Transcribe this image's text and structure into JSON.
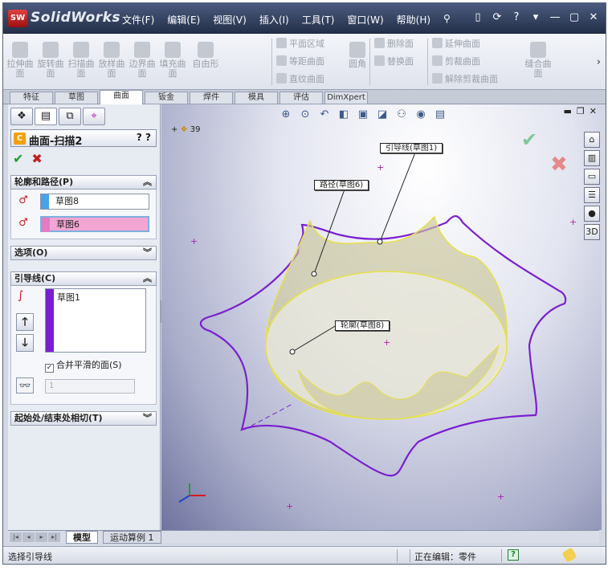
{
  "app": {
    "brand": "SolidWorks",
    "logo_text": "SW",
    "menus": [
      "文件(F)",
      "编辑(E)",
      "视图(V)",
      "插入(I)",
      "工具(T)",
      "窗口(W)",
      "帮助(H)"
    ],
    "title_buttons": [
      "?",
      "▾",
      "—",
      "▢",
      "✕"
    ]
  },
  "ribbon": {
    "tools": [
      {
        "label": "拉伸曲\n面",
        "icon": "extrude-surface-icon"
      },
      {
        "label": "旋转曲\n面",
        "icon": "revolve-surface-icon"
      },
      {
        "label": "扫描曲\n面",
        "icon": "sweep-surface-icon"
      },
      {
        "label": "放样曲\n面",
        "icon": "loft-surface-icon"
      },
      {
        "label": "边界曲\n面",
        "icon": "boundary-surface-icon"
      },
      {
        "label": "填充曲\n面",
        "icon": "fill-surface-icon"
      },
      {
        "label": "自由形",
        "icon": "freeform-icon"
      }
    ],
    "col1": [
      "平面区域",
      "等距曲面",
      "直纹曲面"
    ],
    "round": "圆角",
    "col2": [
      "删除面",
      "替换面"
    ],
    "col3": [
      "延伸曲面",
      "剪裁曲面",
      "解除剪裁曲面"
    ],
    "knit": "缝合曲\n面",
    "more": "›"
  },
  "cmd_tabs": [
    "特征",
    "草图",
    "曲面",
    "钣金",
    "焊件",
    "模具",
    "评估",
    "DimXpert"
  ],
  "active_tab": "曲面",
  "panel": {
    "feature_title": "曲面-扫描2",
    "help": "? ?",
    "ok": "✔",
    "cancel": "✖",
    "section_profile": "轮廓和路径(P)",
    "profile_value": "草图8",
    "path_value": "草图6",
    "section_options": "选项(O)",
    "section_guides": "引导线(C)",
    "guide_item": "草图1",
    "merge_label": "合并平滑的面(S)",
    "merge_checked": "✓",
    "spin_value": "1",
    "section_tangency": "起始处/结束处相切(T)",
    "chevrons": {
      "up": "︽",
      "down": "︾"
    }
  },
  "viewport": {
    "feature_count": "39",
    "callouts": {
      "guide": "引导线(草图1)",
      "path": "路径(草图6)",
      "profile": "轮廓(草图8)"
    },
    "colors": {
      "path": "#7a1fd0",
      "surface_fill": "#c9c49a",
      "surface_edge": "#e6e24a"
    },
    "right_icons": [
      "house-icon",
      "chart-icon",
      "folder-icon",
      "list-icon",
      "sphere-icon",
      "3d-icon"
    ]
  },
  "bottom_tabs": [
    "模型",
    "运动算例 1"
  ],
  "status": {
    "left": "选择引导线",
    "editing": "正在编辑：零件",
    "help_icon": "?"
  }
}
